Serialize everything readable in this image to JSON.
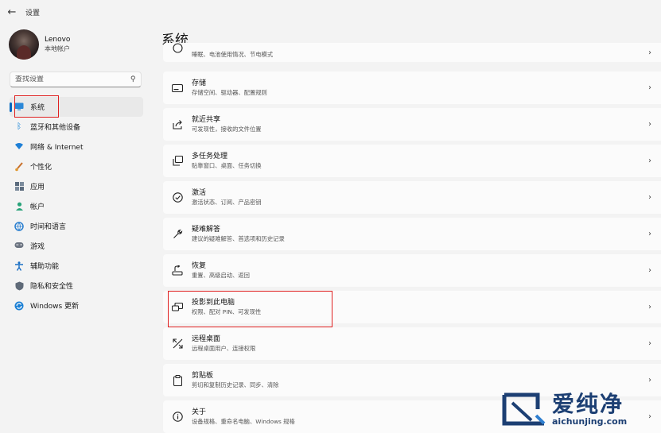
{
  "window": {
    "title": "设置"
  },
  "user": {
    "name": "Lenovo",
    "account_type": "本地帐户"
  },
  "search": {
    "placeholder": "查找设置"
  },
  "nav": [
    {
      "label": "系统",
      "icon": "monitor-icon",
      "active": true
    },
    {
      "label": "蓝牙和其他设备",
      "icon": "bluetooth-icon"
    },
    {
      "label": "网络 & Internet",
      "icon": "wifi-icon"
    },
    {
      "label": "个性化",
      "icon": "brush-icon"
    },
    {
      "label": "应用",
      "icon": "apps-icon"
    },
    {
      "label": "帐户",
      "icon": "person-icon"
    },
    {
      "label": "时间和语言",
      "icon": "globe-clock-icon"
    },
    {
      "label": "游戏",
      "icon": "gamepad-icon"
    },
    {
      "label": "辅助功能",
      "icon": "accessibility-icon"
    },
    {
      "label": "隐私和安全性",
      "icon": "shield-icon"
    },
    {
      "label": "Windows 更新",
      "icon": "update-icon"
    }
  ],
  "page": {
    "title": "系统"
  },
  "cards": [
    {
      "title": "",
      "subtitle": "睡眠、电池使用情况、节电模式",
      "icon": "power-icon"
    },
    {
      "title": "存储",
      "subtitle": "存储空间、驱动器、配置规则",
      "icon": "storage-icon"
    },
    {
      "title": "就近共享",
      "subtitle": "可发现性，接收的文件位置",
      "icon": "share-icon"
    },
    {
      "title": "多任务处理",
      "subtitle": "贴靠窗口、桌面、任务切换",
      "icon": "multitask-icon"
    },
    {
      "title": "激活",
      "subtitle": "激活状态、订阅、产品密钥",
      "icon": "check-circle-icon"
    },
    {
      "title": "疑难解答",
      "subtitle": "建议的疑难解答、首选项和历史记录",
      "icon": "wrench-icon"
    },
    {
      "title": "恢复",
      "subtitle": "重置、高级启动、返回",
      "icon": "recovery-icon"
    },
    {
      "title": "投影到此电脑",
      "subtitle": "权限、配对 PIN、可发现性",
      "icon": "project-icon"
    },
    {
      "title": "远程桌面",
      "subtitle": "远程桌面用户、连接权限",
      "icon": "remote-desktop-icon"
    },
    {
      "title": "剪贴板",
      "subtitle": "剪切和复制历史记录、同步、清除",
      "icon": "clipboard-icon"
    },
    {
      "title": "关于",
      "subtitle": "设备规格、重命名电脑、Windows 规格",
      "icon": "info-icon"
    }
  ],
  "watermark": {
    "brand": "爱纯净",
    "url": "aichunjing.com"
  },
  "colors": {
    "accent": "#0067c0",
    "highlight_box": "#e02020",
    "watermark": "#1c3f73"
  }
}
